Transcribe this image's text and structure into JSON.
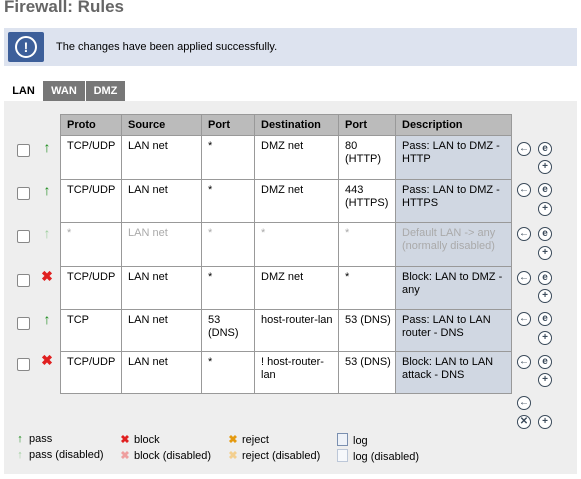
{
  "page_title": "Firewall: Rules",
  "alert": {
    "icon": "info-exclamation-icon",
    "message": "The changes have been applied successfully."
  },
  "tabs": [
    {
      "label": "LAN",
      "active": true
    },
    {
      "label": "WAN",
      "active": false
    },
    {
      "label": "DMZ",
      "active": false
    }
  ],
  "table": {
    "headers": [
      "Proto",
      "Source",
      "Port",
      "Destination",
      "Port",
      "Description"
    ],
    "rows": [
      {
        "action": "pass",
        "disabled": false,
        "proto": "TCP/UDP",
        "source": "LAN net",
        "src_port": "*",
        "destination": "DMZ net",
        "dst_port": "80 (HTTP)",
        "description": "Pass: LAN to DMZ - HTTP"
      },
      {
        "action": "pass",
        "disabled": false,
        "proto": "TCP/UDP",
        "source": "LAN net",
        "src_port": "*",
        "destination": "DMZ net",
        "dst_port": "443 (HTTPS)",
        "description": "Pass: LAN to DMZ - HTTPS"
      },
      {
        "action": "pass",
        "disabled": true,
        "proto": "*",
        "source": "LAN net",
        "src_port": "*",
        "destination": "*",
        "dst_port": "*",
        "description": "Default LAN -> any (normally disabled)"
      },
      {
        "action": "block",
        "disabled": false,
        "proto": "TCP/UDP",
        "source": "LAN net",
        "src_port": "*",
        "destination": "DMZ net",
        "dst_port": "*",
        "description": "Block: LAN to DMZ - any"
      },
      {
        "action": "pass",
        "disabled": false,
        "proto": "TCP",
        "source": "LAN net",
        "src_port": "53 (DNS)",
        "destination": "host-router-lan",
        "dst_port": "53 (DNS)",
        "description": "Pass: LAN to LAN router - DNS"
      },
      {
        "action": "block",
        "disabled": false,
        "proto": "TCP/UDP",
        "source": "LAN net",
        "src_port": "*",
        "destination": "! host-router-lan",
        "dst_port": "53 (DNS)",
        "description": "Block: LAN to LAN attack - DNS"
      }
    ]
  },
  "row_buttons": {
    "move": "move-left-icon",
    "edit": "edit-icon",
    "add": "add-icon",
    "delete": "delete-icon"
  },
  "legend": {
    "pass": "pass",
    "pass_disabled": "pass (disabled)",
    "block": "block",
    "block_disabled": "block (disabled)",
    "reject": "reject",
    "reject_disabled": "reject (disabled)",
    "log": "log",
    "log_disabled": "log (disabled)"
  }
}
